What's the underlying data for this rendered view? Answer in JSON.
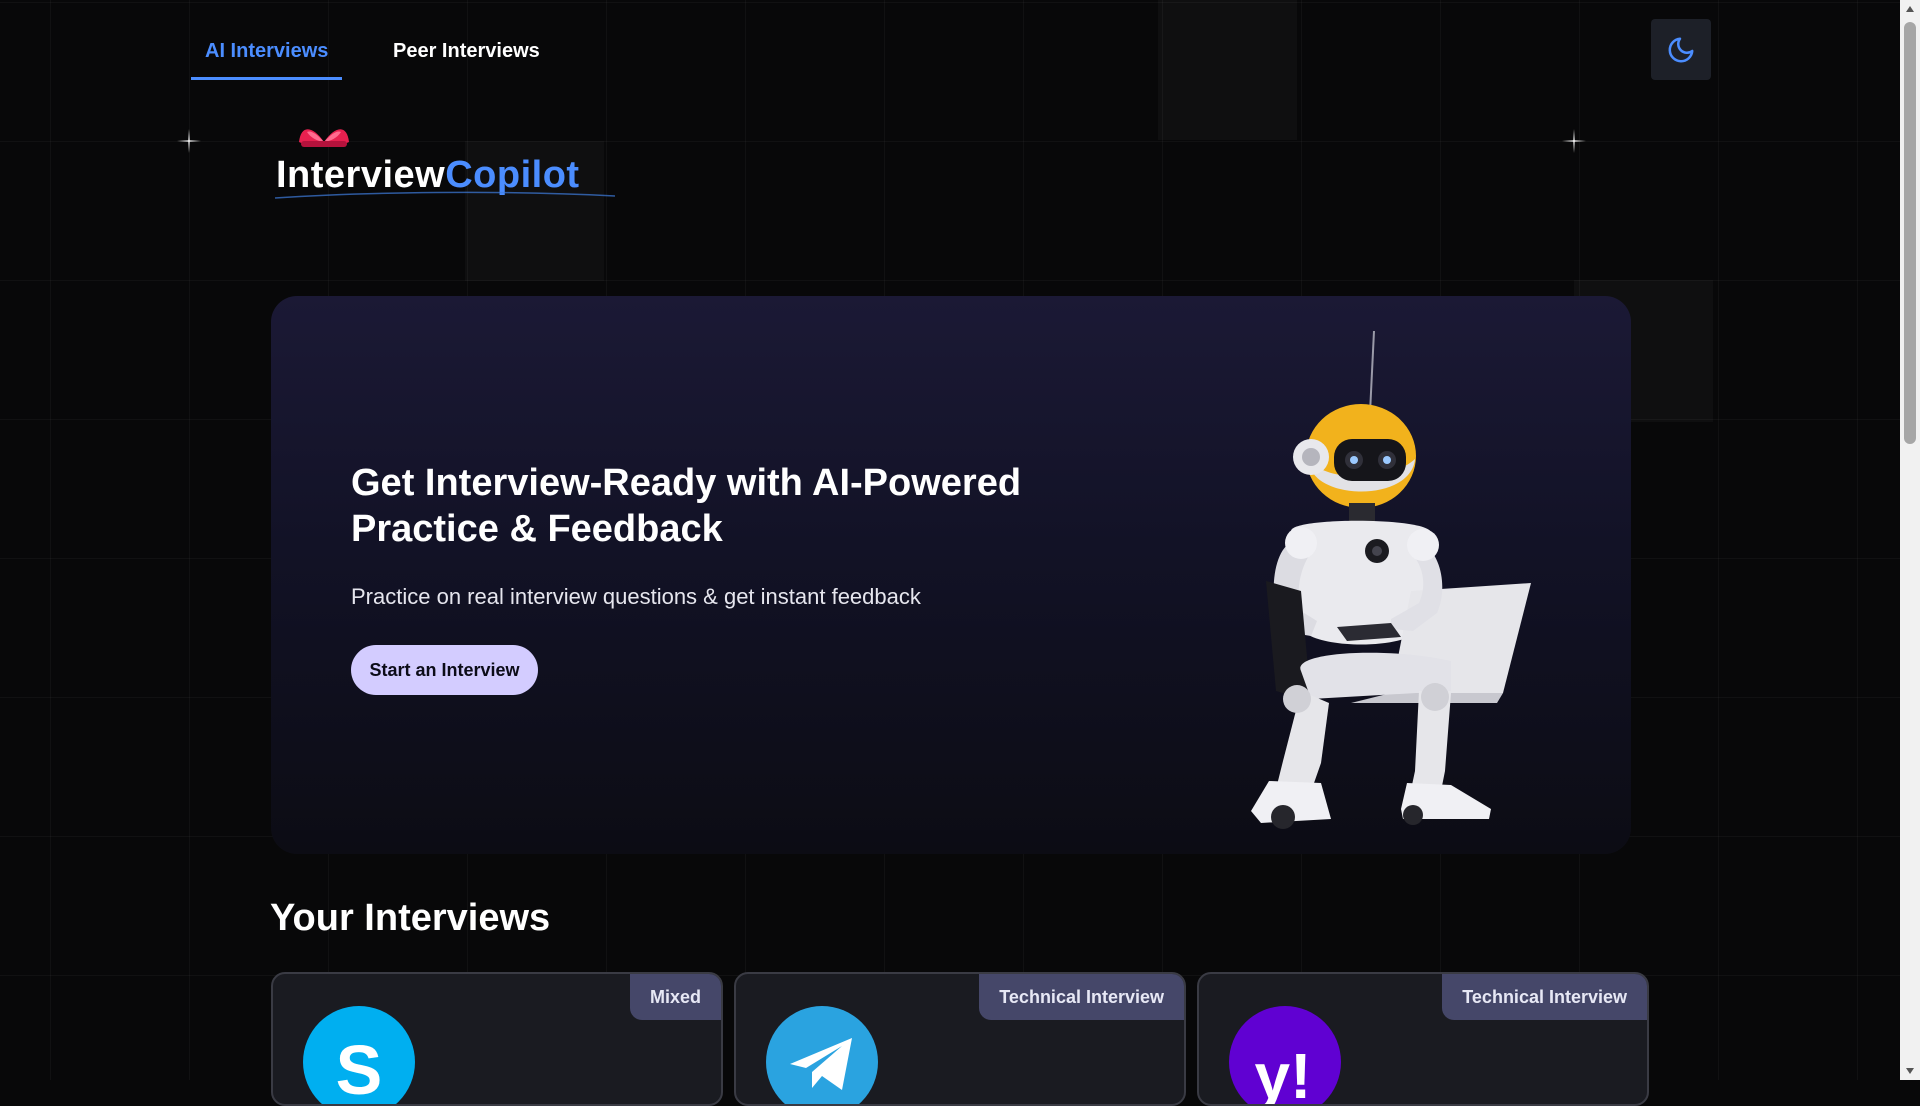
{
  "nav": {
    "tabs": [
      {
        "label": "AI Interviews",
        "active": true
      },
      {
        "label": "Peer Interviews",
        "active": false
      }
    ],
    "theme_toggle_icon": "moon-icon"
  },
  "logo": {
    "part1": "Interview",
    "part2": "Copilot"
  },
  "hero": {
    "title": "Get Interview-Ready with AI-Powered Practice & Feedback",
    "subtitle": "Practice on real interview questions & get instant feedback",
    "cta_label": "Start an Interview"
  },
  "section": {
    "title": "Your Interviews"
  },
  "interviews": [
    {
      "badge": "Mixed",
      "logo": "skype-icon",
      "color": "#00aff0"
    },
    {
      "badge": "Technical Interview",
      "logo": "telegram-icon",
      "color": "#2aa3e0"
    },
    {
      "badge": "Technical Interview",
      "logo": "yahoo-icon",
      "color": "#6001d2"
    }
  ],
  "colors": {
    "accent": "#4b8dff",
    "cta": "#d3ccff",
    "badge": "#454769"
  }
}
